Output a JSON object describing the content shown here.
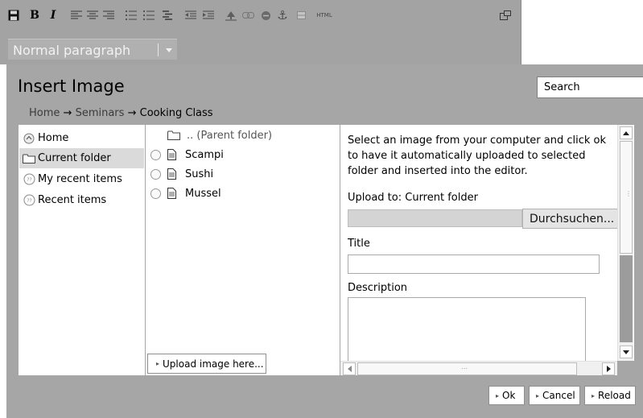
{
  "toolbar": {
    "buttons": [
      {
        "name": "save-icon"
      },
      {
        "name": "bold-button",
        "label": "B"
      },
      {
        "name": "italic-button",
        "label": "I"
      },
      {
        "name": "align-left-icon"
      },
      {
        "name": "align-center-icon"
      },
      {
        "name": "align-right-icon"
      },
      {
        "name": "bullet-list-icon"
      },
      {
        "name": "numbered-list-icon"
      },
      {
        "name": "definition-list-icon"
      },
      {
        "name": "outdent-icon"
      },
      {
        "name": "indent-icon"
      },
      {
        "name": "insert-image-icon"
      },
      {
        "name": "insert-link-icon"
      },
      {
        "name": "unlink-icon"
      },
      {
        "name": "anchor-icon"
      },
      {
        "name": "table-icon"
      },
      {
        "name": "html-button",
        "label": "HTML"
      },
      {
        "name": "maximize-icon"
      }
    ],
    "format_select": {
      "value": "Normal paragraph"
    }
  },
  "dialog": {
    "title": "Insert Image",
    "search": {
      "value": "Search"
    },
    "breadcrumb": [
      {
        "label": "Home",
        "current": false
      },
      {
        "label": "Seminars",
        "current": false
      },
      {
        "label": "Cooking Class",
        "current": true
      }
    ],
    "breadcrumb_separator": "→",
    "nav": [
      {
        "label": "Home",
        "icon": "home-icon",
        "selected": false
      },
      {
        "label": "Current folder",
        "icon": "folder-icon",
        "selected": true
      },
      {
        "label": "My recent items",
        "icon": "recent-icon",
        "selected": false
      },
      {
        "label": "Recent items",
        "icon": "recent-icon",
        "selected": false
      }
    ],
    "files": {
      "parent": ".. (Parent folder)",
      "items": [
        "Scampi",
        "Sushi",
        "Mussel"
      ],
      "upload_button": "Upload image here..."
    },
    "upload": {
      "instructions": "Select an image from your computer and click ok to have it automatically uploaded to selected folder and inserted into the editor.",
      "upload_to_label": "Upload to: Current folder",
      "browse_label": "Durchsuchen...",
      "title_label": "Title",
      "title_value": "",
      "description_label": "Description",
      "description_value": ""
    },
    "buttons": {
      "ok": "Ok",
      "cancel": "Cancel",
      "reload": "Reload"
    }
  },
  "colors": {
    "chrome": "#a6a6a6",
    "panel": "#ffffff",
    "selected_row": "#dadada"
  }
}
